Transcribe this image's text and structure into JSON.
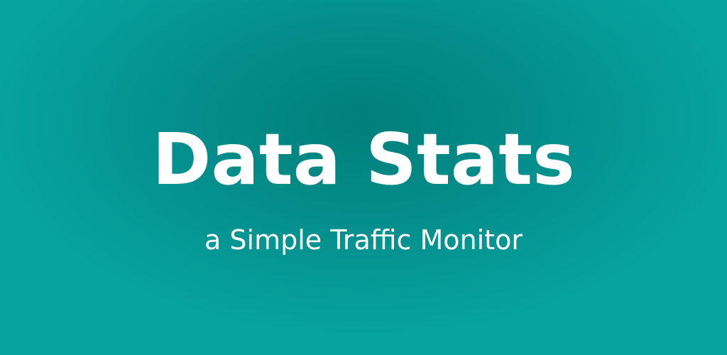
{
  "banner": {
    "title": "Data Stats",
    "subtitle": "a Simple Traffic Monitor"
  },
  "colors": {
    "background_center": "#007f7c",
    "background_edge": "#06a39f",
    "text": "#ffffff"
  }
}
